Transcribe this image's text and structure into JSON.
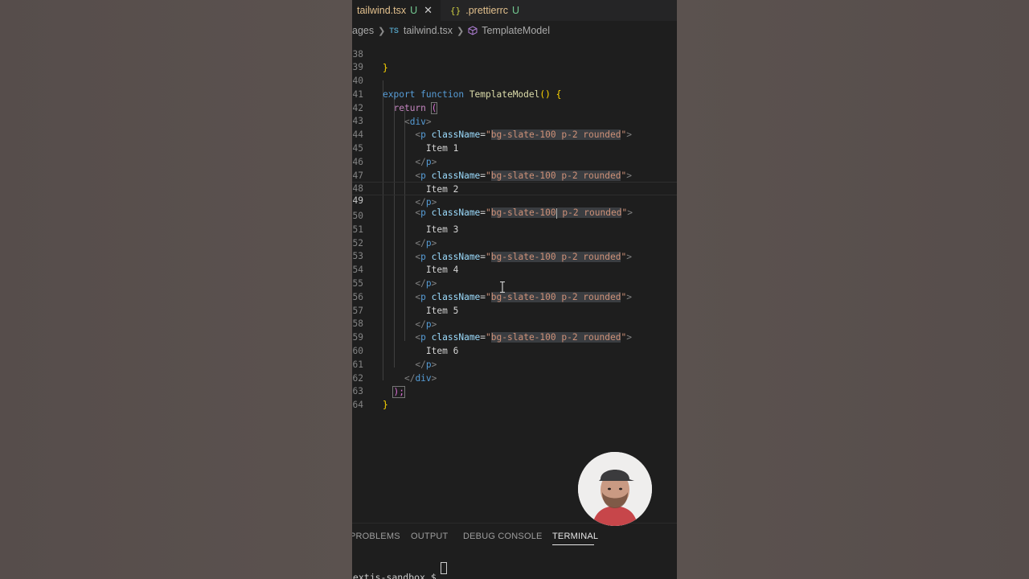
{
  "tabs": [
    {
      "name": "tailwind.tsx",
      "status": "U",
      "active": true
    },
    {
      "name": ".prettierrc",
      "status": "U",
      "active": false
    }
  ],
  "breadcrumb": {
    "folder": "ages",
    "file_badge": "TS",
    "file": "tailwind.tsx",
    "symbol": "TemplateModel"
  },
  "editor": {
    "current_line": "49",
    "lines": [
      {
        "n": "38"
      },
      {
        "n": "39"
      },
      {
        "n": "40",
        "t1": "export",
        "t2": "function",
        "t3": "TemplateModel",
        "t4": "()",
        "t5": "{"
      },
      {
        "n": "41",
        "t1": "return",
        "t2": "("
      },
      {
        "n": "42",
        "t1": "<",
        "t2": "div",
        "t3": ">"
      },
      {
        "n": "43",
        "a": "className",
        "s": "bg-slate-100 p-2 rounded"
      },
      {
        "n": "44",
        "t": "Item 1"
      },
      {
        "n": "45"
      },
      {
        "n": "46",
        "a": "className",
        "s": "bg-slate-100 p-2 rounded"
      },
      {
        "n": "47",
        "t": "Item 2"
      },
      {
        "n": "48"
      },
      {
        "n": "49",
        "a": "className",
        "s1": "bg-slate-100",
        "s2": " p-2 rounded"
      },
      {
        "n": "50",
        "t": "Item 3"
      },
      {
        "n": "51"
      },
      {
        "n": "52",
        "a": "className",
        "s": "bg-slate-100 p-2 rounded"
      },
      {
        "n": "53",
        "t": "Item 4"
      },
      {
        "n": "54"
      },
      {
        "n": "55",
        "a": "className",
        "s": "bg-slate-100 p-2 rounded"
      },
      {
        "n": "56",
        "t": "Item 5"
      },
      {
        "n": "57"
      },
      {
        "n": "58",
        "a": "className",
        "s": "bg-slate-100 p-2 rounded"
      },
      {
        "n": "59",
        "t": "Item 6"
      },
      {
        "n": "60"
      },
      {
        "n": "61"
      },
      {
        "n": "62",
        "t": ");"
      },
      {
        "n": "63",
        "t": "}"
      },
      {
        "n": "64"
      }
    ]
  },
  "panel": {
    "tabs": [
      "PROBLEMS",
      "OUTPUT",
      "DEBUG CONSOLE",
      "TERMINAL"
    ],
    "active": "TERMINAL",
    "prompt": "nextjs-sandbox $ "
  },
  "colors": {
    "editor_bg": "#1e1e1e",
    "keyword": "#569cd6",
    "string": "#ce9178",
    "attribute": "#9cdcfe",
    "untracked": "#73c991",
    "modified_file": "#e2c08d"
  }
}
